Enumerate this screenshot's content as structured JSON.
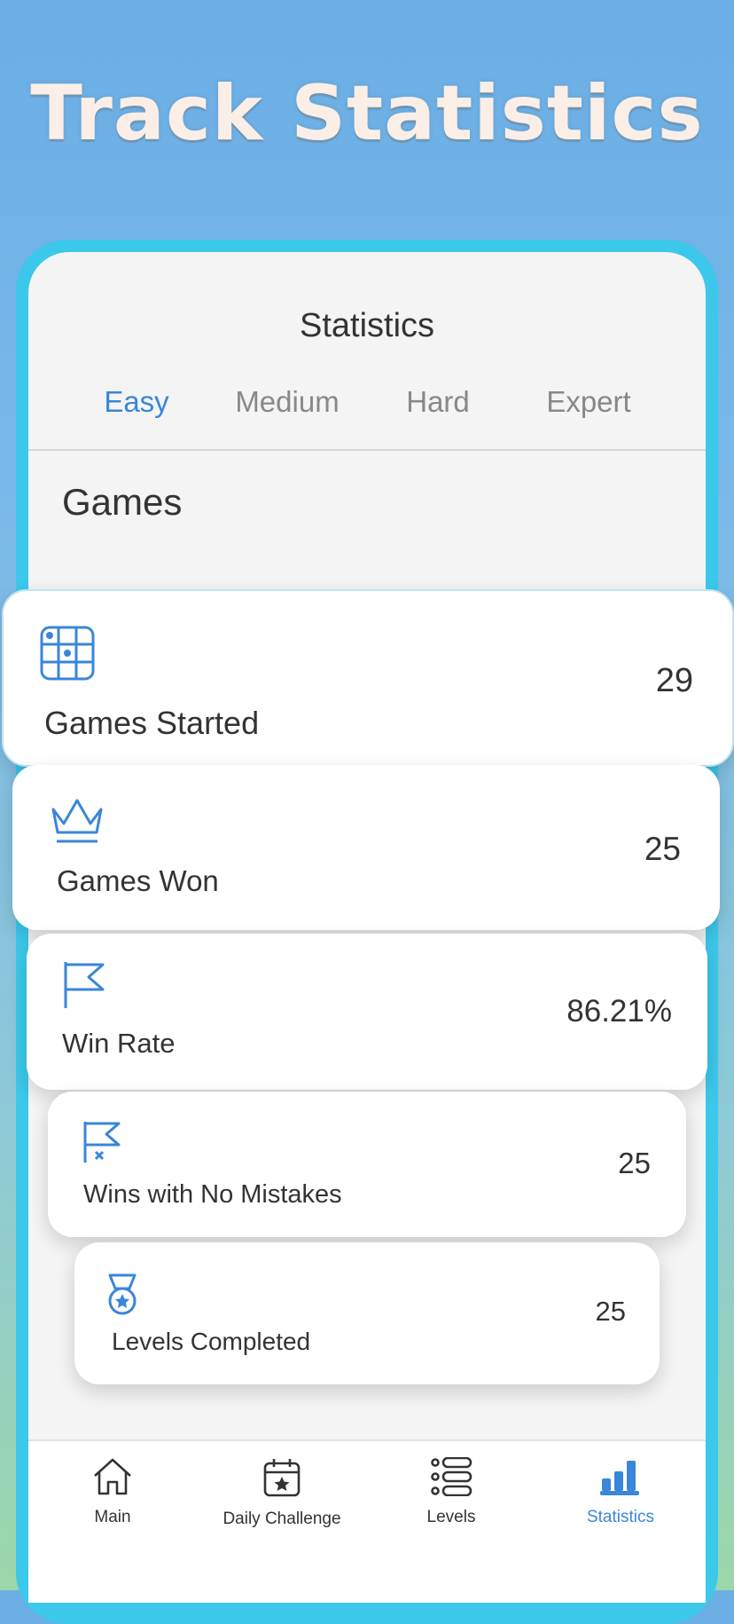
{
  "headline": "Track Statistics",
  "screen": {
    "title": "Statistics",
    "tabs": [
      {
        "label": "Easy",
        "active": true
      },
      {
        "label": "Medium",
        "active": false
      },
      {
        "label": "Hard",
        "active": false
      },
      {
        "label": "Expert",
        "active": false
      }
    ],
    "section_title": "Games"
  },
  "stats": [
    {
      "icon": "grid-icon",
      "label": "Games Started",
      "value": "29"
    },
    {
      "icon": "crown-icon",
      "label": "Games Won",
      "value": "25"
    },
    {
      "icon": "flag-icon",
      "label": "Win Rate",
      "value": "86.21%"
    },
    {
      "icon": "flag-x-icon",
      "label": "Wins with No Mistakes",
      "value": "25"
    },
    {
      "icon": "medal-icon",
      "label": "Levels Completed",
      "value": "25"
    }
  ],
  "nav": [
    {
      "icon": "home-icon",
      "label": "Main",
      "active": false
    },
    {
      "icon": "calendar-star-icon",
      "label": "Daily Challenge",
      "active": false
    },
    {
      "icon": "list-icon",
      "label": "Levels",
      "active": false
    },
    {
      "icon": "bar-chart-icon",
      "label": "Statistics",
      "active": true
    }
  ],
  "colors": {
    "accent": "#3a86d8",
    "frame": "#3cc8ea",
    "text": "#333333",
    "inactive": "#888888"
  }
}
